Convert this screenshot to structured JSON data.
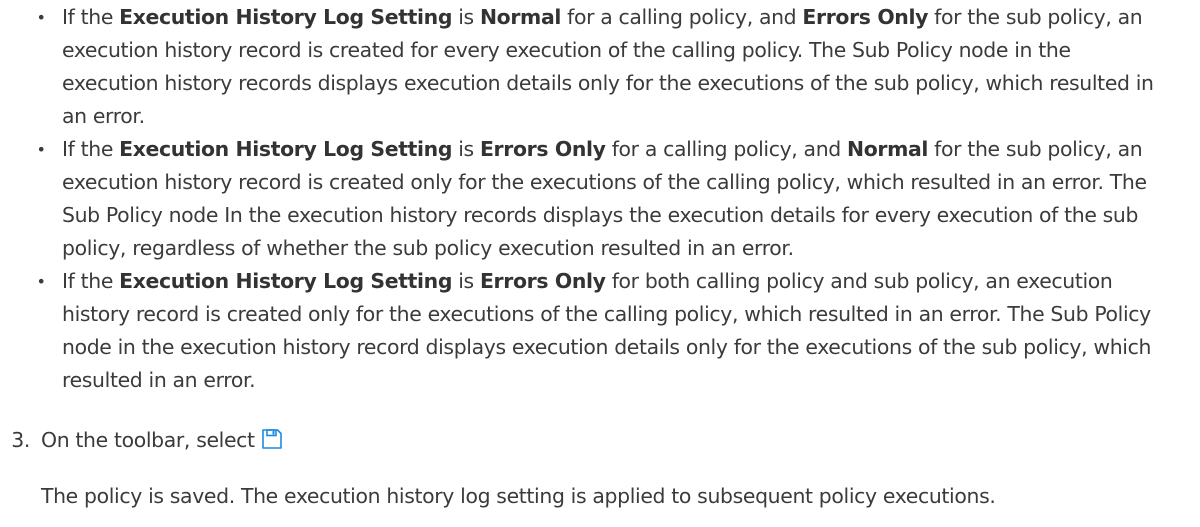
{
  "bullets": [
    {
      "segments": [
        {
          "text": "If the ",
          "bold": false
        },
        {
          "text": "Execution History Log Setting",
          "bold": true
        },
        {
          "text": " is ",
          "bold": false
        },
        {
          "text": "Normal",
          "bold": true
        },
        {
          "text": " for a calling policy, and ",
          "bold": false
        },
        {
          "text": "Errors Only",
          "bold": true
        },
        {
          "text": " for the sub policy, an execution history record is created for every execution of the calling policy. The Sub Policy node in the execution history records displays execution details only for the executions of the sub policy, which resulted in an error.",
          "bold": false
        }
      ]
    },
    {
      "segments": [
        {
          "text": "If the ",
          "bold": false
        },
        {
          "text": "Execution History Log Setting",
          "bold": true
        },
        {
          "text": " is ",
          "bold": false
        },
        {
          "text": "Errors Only",
          "bold": true
        },
        {
          "text": " for a calling policy, and ",
          "bold": false
        },
        {
          "text": "Normal",
          "bold": true
        },
        {
          "text": " for the sub policy, an execution history record is created only for the executions of the calling policy, which resulted in an error. The Sub Policy node In the execution history records displays the execution details for every execution of the sub policy, regardless of whether the sub policy execution resulted in an error.",
          "bold": false
        }
      ]
    },
    {
      "segments": [
        {
          "text": "If the ",
          "bold": false
        },
        {
          "text": "Execution History Log Setting",
          "bold": true
        },
        {
          "text": " is ",
          "bold": false
        },
        {
          "text": "Errors Only",
          "bold": true
        },
        {
          "text": " for both calling policy and sub policy, an execution history record is created only for the executions of the calling policy, which resulted in an error. The Sub Policy node in the execution history record displays execution details only for the executions of the sub policy, which resulted in an error.",
          "bold": false
        }
      ]
    }
  ],
  "step": {
    "number": "3.",
    "instruction": "On the toolbar, select",
    "icon": "save-icon",
    "result": "The policy is saved. The execution history log setting is applied to subsequent policy executions."
  },
  "colors": {
    "text": "#3b3b3b",
    "icon": "#1e8ae0"
  }
}
